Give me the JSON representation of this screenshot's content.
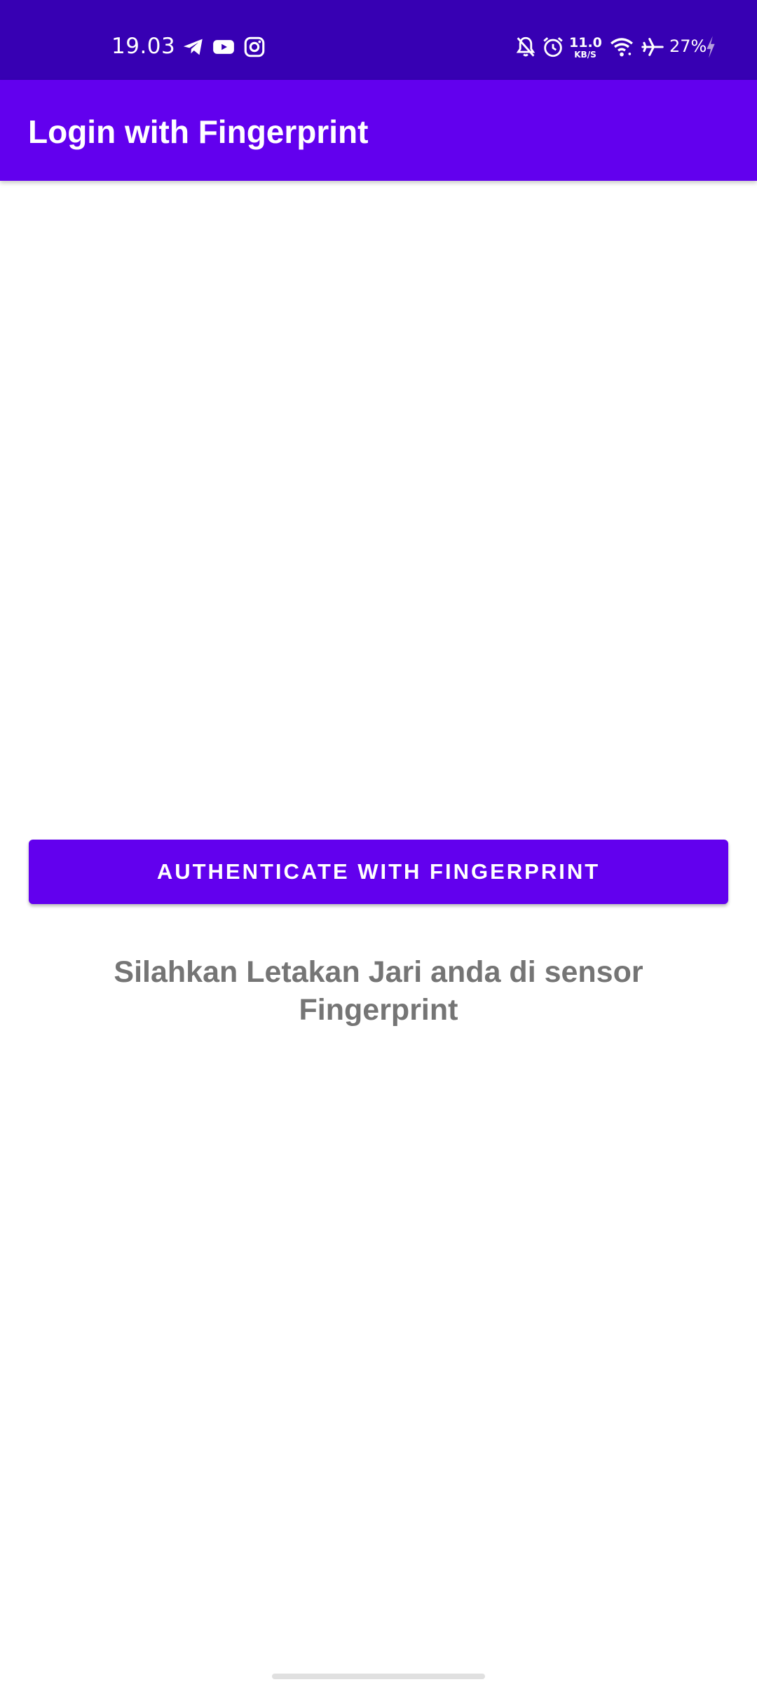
{
  "status_bar": {
    "time": "19.03",
    "notification_icons": [
      "telegram-icon",
      "youtube-icon",
      "instagram-icon"
    ],
    "system_icons": [
      "bell-off-icon",
      "alarm-icon",
      "wifi-icon",
      "airplane-icon",
      "charging-icon"
    ],
    "network_speed_value": "11.0",
    "network_speed_unit": "KB/S",
    "battery": "27%",
    "background_color": "#3700b3"
  },
  "app_bar": {
    "title": "Login with Fingerprint",
    "background_color": "#6200ee"
  },
  "main": {
    "auth_button_label": "AUTHENTICATE WITH FINGERPRINT",
    "instruction": "Silahkan Letakan Jari anda di sensor Fingerprint",
    "accent_color": "#6200ee",
    "instruction_color": "#757575"
  }
}
